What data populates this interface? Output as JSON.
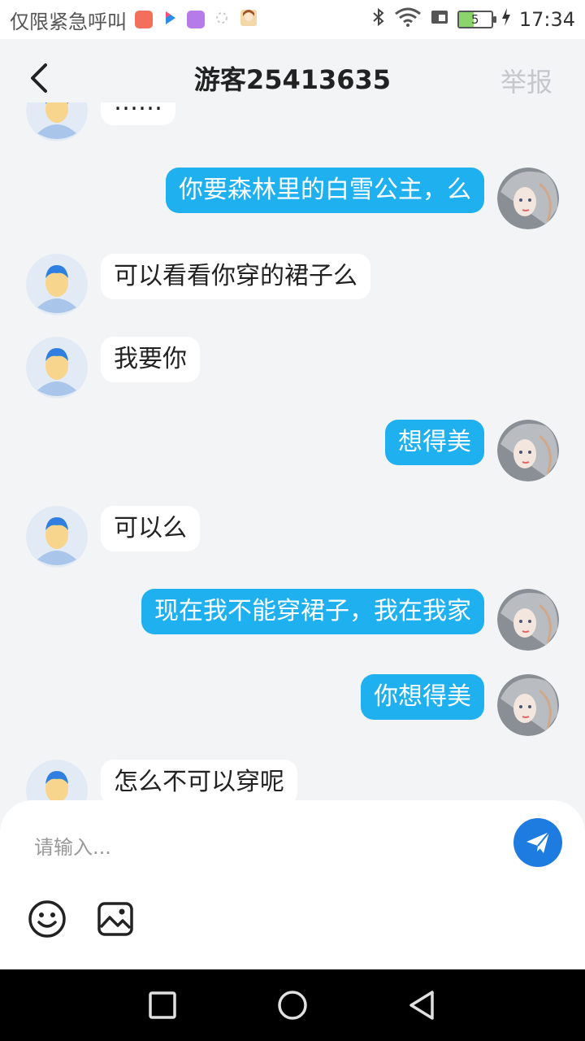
{
  "status_bar": {
    "left_text": "仅限紧急呼叫",
    "battery_level": "5",
    "time": "17:34",
    "app_icons": [
      "mail-icon",
      "youku-icon",
      "gallery-icon",
      "loading-icon",
      "character-icon"
    ]
  },
  "header": {
    "title": "游客25413635",
    "report_label": "举报"
  },
  "messages": [
    {
      "side": "left",
      "text": "……"
    },
    {
      "side": "right",
      "text": "你要森林里的白雪公主，么"
    },
    {
      "side": "left",
      "text": "可以看看你穿的裙子么"
    },
    {
      "side": "left",
      "text": "我要你"
    },
    {
      "side": "right",
      "text": "想得美"
    },
    {
      "side": "left",
      "text": "可以么"
    },
    {
      "side": "right",
      "text": "现在我不能穿裙子，我在我家"
    },
    {
      "side": "right",
      "text": "你想得美"
    },
    {
      "side": "left",
      "text": "怎么不可以穿呢"
    }
  ],
  "input": {
    "placeholder": "请输入..."
  },
  "colors": {
    "accent_bubble": "#1fb0f0",
    "send_button": "#1e7be0",
    "background": "#f2f4f6"
  }
}
